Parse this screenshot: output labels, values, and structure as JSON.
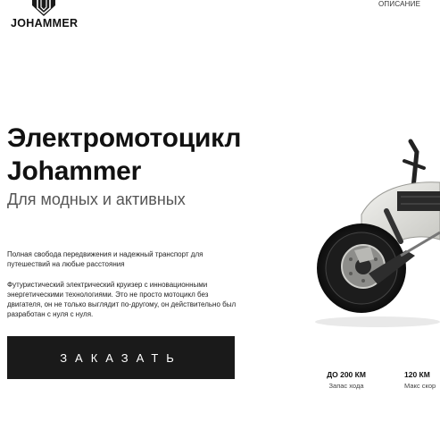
{
  "header": {
    "logo_text": "JOHAMMER",
    "nav_link": "ОПИСАНИЕ"
  },
  "hero": {
    "title_line1": "Электромотоцикл",
    "title_line2": "Johammer",
    "subtitle": "Для модных и активных",
    "description_1": "Полная свобода передвижения и надежный транспорт для путешествий на любые расстояния",
    "description_2": "Футуристический электрический круизер с инновационными энергетическими технологиями. Это не просто мотоцикл без двигателя, он не только выглядит по-другому, он действительно был разработан с нуля с нуля.",
    "order_button": "ЗАКАЗАТЬ"
  },
  "stats": [
    {
      "value": "ДО 200 КМ",
      "label": "Запас хода"
    },
    {
      "value": "120 КМ",
      "label": "Макс скор"
    }
  ],
  "colors": {
    "button_bg": "#1a1a1a",
    "text": "#111111",
    "subtitle": "#555555"
  }
}
